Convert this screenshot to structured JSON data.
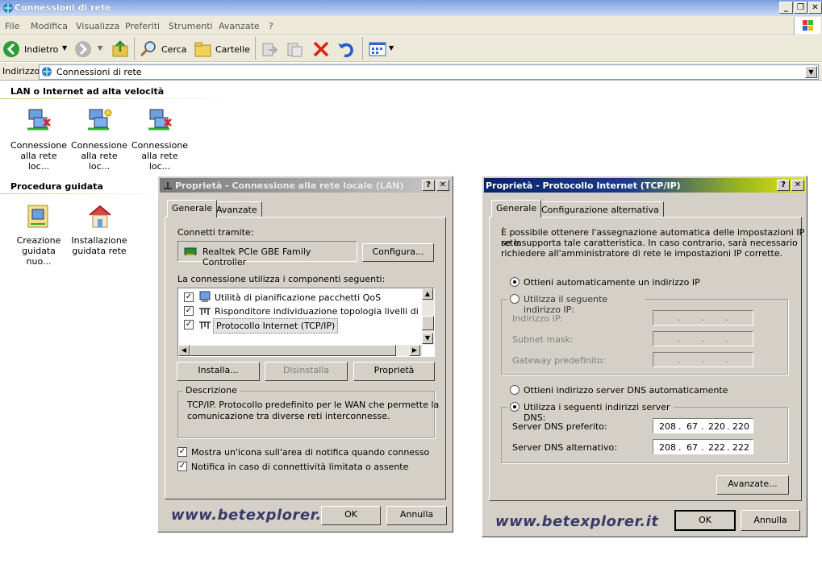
{
  "window": {
    "title": "Connessioni di rete"
  },
  "menu": [
    "File",
    "Modifica",
    "Visualizza",
    "Preferiti",
    "Strumenti",
    "Avanzate",
    "?"
  ],
  "toolbar": {
    "back": "Indietro",
    "search": "Cerca",
    "folders": "Cartelle"
  },
  "address": {
    "label": "Indirizzo",
    "value": "Connessioni di rete"
  },
  "lan_section": {
    "title": "LAN o Internet ad alta velocità",
    "items": [
      {
        "line1": "Connessione",
        "line2": "alla rete loc..."
      },
      {
        "line1": "Connessione",
        "line2": "alla rete loc..."
      },
      {
        "line1": "Connessione",
        "line2": "alla rete loc..."
      }
    ]
  },
  "wizard_section": {
    "title": "Procedura guidata",
    "items": [
      {
        "line1": "Creazione",
        "line2": "guidata nuo..."
      },
      {
        "line1": "Installazione",
        "line2": "guidata rete"
      }
    ]
  },
  "lan_dialog": {
    "title": "Proprietà - Connessione alla rete locale (LAN)",
    "tabs": [
      "Generale",
      "Avanzate"
    ],
    "connect_via_label": "Connetti tramite:",
    "adapter": "Realtek PCIe GBE Family Controller",
    "configure": "Configura...",
    "components_label": "La connessione utilizza i componenti seguenti:",
    "components": [
      "Utilità di pianificazione pacchetti QoS",
      "Risponditore individuazione topologia livelli di collegame",
      "Protocollo Internet (TCP/IP)"
    ],
    "install": "Installa...",
    "uninstall": "Disinstalla",
    "properties": "Proprietà",
    "description_title": "Descrizione",
    "description_line1": "TCP/IP. Protocollo predefinito per le WAN che permette la",
    "description_line2": "comunicazione tra diverse reti interconnesse.",
    "show_icon": "Mostra un'icona sull'area di notifica quando connesso",
    "notify_limited": "Notifica in caso di connettività limitata o assente",
    "watermark": "www.betexplorer.it",
    "ok": "OK",
    "cancel": "Annulla"
  },
  "tcp_dialog": {
    "title": "Proprietà - Protocollo Internet (TCP/IP)",
    "tabs": [
      "Generale",
      "Configurazione alternativa"
    ],
    "intro_line1": "È possibile ottenere l'assegnazione automatica delle impostazioni IP se la",
    "intro_line2": "rete supporta tale caratteristica. In caso contrario, sarà necessario",
    "intro_line3": "richiedere all'amministratore di rete le impostazioni IP corrette.",
    "auto_ip": "Ottieni automaticamente un indirizzo IP",
    "manual_ip": "Utilizza il seguente indirizzo IP:",
    "ip_label": "Indirizzo IP:",
    "mask_label": "Subnet mask:",
    "gateway_label": "Gateway predefinito:",
    "auto_dns": "Ottieni indirizzo server DNS automaticamente",
    "manual_dns": "Utilizza i seguenti indirizzi server DNS:",
    "dns_pref_label": "Server DNS preferito:",
    "dns_alt_label": "Server DNS alternativo:",
    "dns_pref": [
      "208",
      "67",
      "220",
      "220"
    ],
    "dns_alt": [
      "208",
      "67",
      "222",
      "222"
    ],
    "advanced": "Avanzate...",
    "watermark": "www.betexplorer.it",
    "ok": "OK",
    "cancel": "Annulla"
  }
}
